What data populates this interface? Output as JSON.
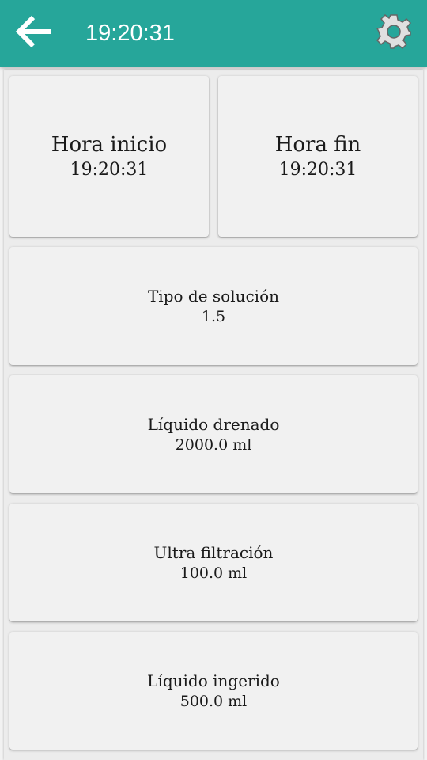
{
  "header": {
    "time": "19:20:31",
    "back_icon": "arrow-left-icon",
    "settings_icon": "gear-icon",
    "bar_color": "#26a69a"
  },
  "cards": {
    "start": {
      "label": "Hora inicio",
      "value": "19:20:31"
    },
    "end": {
      "label": "Hora fin",
      "value": "19:20:31"
    },
    "solution": {
      "label": "Tipo de solución",
      "value": "1.5"
    },
    "drained": {
      "label": "Líquido drenado",
      "value": "2000.0 ml"
    },
    "ultrafiltration": {
      "label": "Ultra filtración",
      "value": "100.0 ml"
    },
    "ingested": {
      "label": "Líquido ingerido",
      "value": "500.0 ml"
    }
  }
}
